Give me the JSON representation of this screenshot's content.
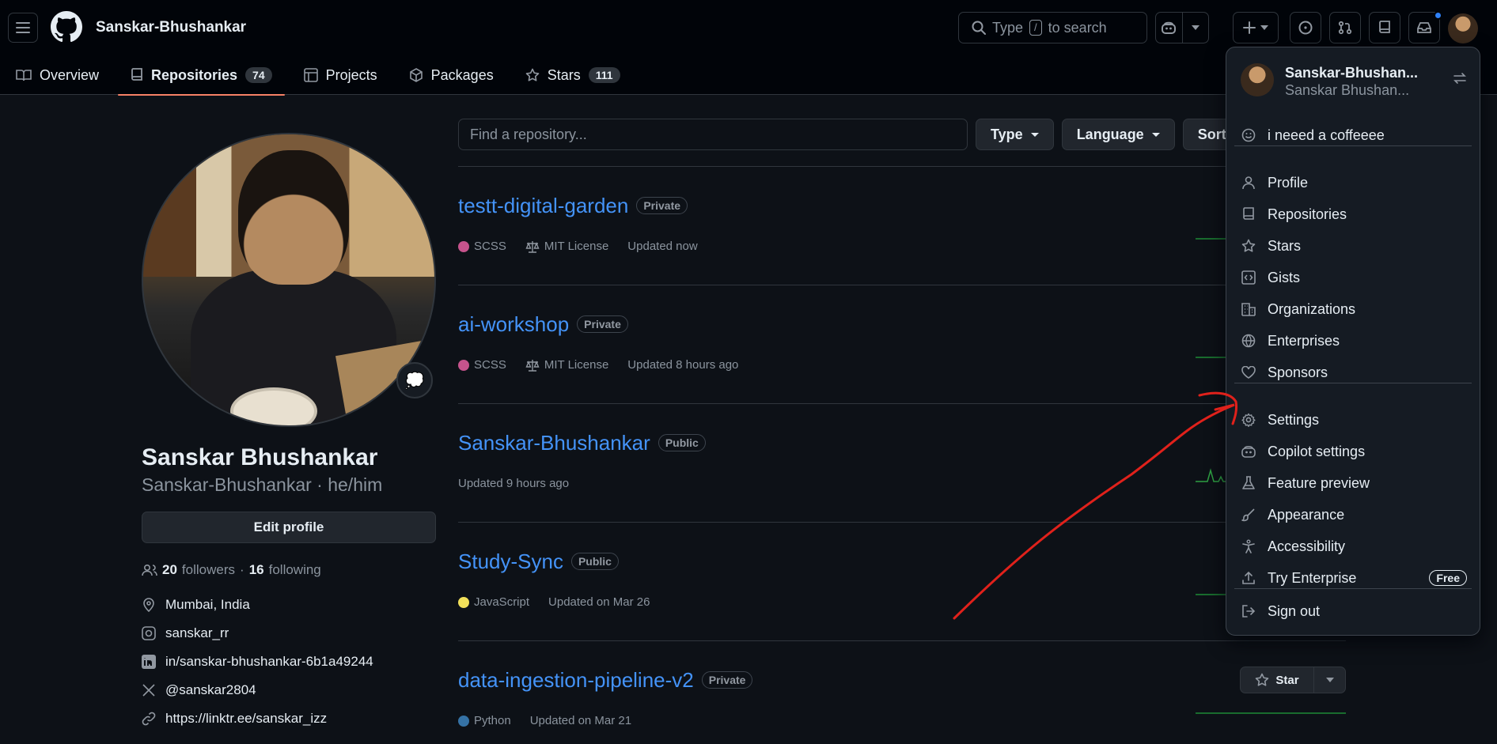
{
  "header": {
    "username": "Sanskar-Bhushankar",
    "search": {
      "prefix": "Type",
      "key": "/",
      "suffix": "to search"
    }
  },
  "tabs": [
    {
      "label": "Overview",
      "count": null
    },
    {
      "label": "Repositories",
      "count": "74"
    },
    {
      "label": "Projects",
      "count": null
    },
    {
      "label": "Packages",
      "count": null
    },
    {
      "label": "Stars",
      "count": "111"
    }
  ],
  "profile": {
    "status_emoji": "💭",
    "name": "Sanskar Bhushankar",
    "login_line": "Sanskar-Bhushankar · he/him",
    "edit_label": "Edit profile",
    "followers_count": "20",
    "followers_label": "followers",
    "following_count": "16",
    "following_label": "following",
    "separator": "·",
    "location": "Mumbai, India",
    "instagram": "sanskar_rr",
    "linkedin": "in/sanskar-bhushankar-6b1a49244",
    "twitter": "@sanskar2804",
    "website": "https://linktr.ee/sanskar_izz"
  },
  "filters": {
    "placeholder": "Find a repository...",
    "type": "Type",
    "language": "Language",
    "sort": "Sort"
  },
  "repos": [
    {
      "name": "testt-digital-garden",
      "visibility": "Private",
      "language": "SCSS",
      "lang_color": "#c6538c",
      "license": "MIT License",
      "updated": "Updated now"
    },
    {
      "name": "ai-workshop",
      "visibility": "Private",
      "language": "SCSS",
      "lang_color": "#c6538c",
      "license": "MIT License",
      "updated": "Updated 8 hours ago"
    },
    {
      "name": "Sanskar-Bhushankar",
      "visibility": "Public",
      "language": "",
      "lang_color": "",
      "license": "",
      "updated": "Updated 9 hours ago"
    },
    {
      "name": "Study-Sync",
      "visibility": "Public",
      "language": "JavaScript",
      "lang_color": "#f1e05a",
      "license": "",
      "updated": "Updated on Mar 26"
    },
    {
      "name": "data-ingestion-pipeline-v2",
      "visibility": "Private",
      "language": "Python",
      "lang_color": "#3572A5",
      "license": "",
      "updated": "Updated on Mar 21"
    }
  ],
  "star_label": "Star",
  "menu": {
    "login": "Sanskar-Bhushan...",
    "name": "Sanskar Bhushan...",
    "status": "i neeed a coffeeee",
    "items": [
      "Profile",
      "Repositories",
      "Stars",
      "Gists",
      "Organizations",
      "Enterprises",
      "Sponsors",
      "Settings",
      "Copilot settings",
      "Feature preview",
      "Appearance",
      "Accessibility",
      "Try Enterprise",
      "Sign out"
    ],
    "free_badge": "Free"
  },
  "colors": {
    "accent": "#4493f8",
    "tab_underline": "#f78166",
    "annotation": "#e0211b"
  }
}
